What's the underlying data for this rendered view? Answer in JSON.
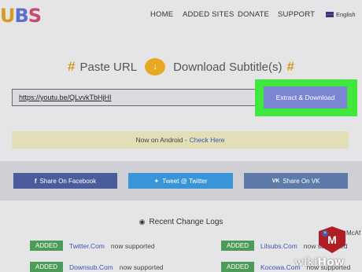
{
  "header": {
    "logo_part1": "U",
    "logo_part2": "B",
    "logo_part3": "S",
    "nav": [
      "HOME",
      "ADDED SITES",
      "DONATE",
      "SUPPORT"
    ],
    "language": "English"
  },
  "hero": {
    "hash_left": "#",
    "paste_label": "Paste URL",
    "download_label": "Download Subtitle(s)",
    "hash_right": "#"
  },
  "form": {
    "url_value": "https://youtu.be/QLvvkTbHjHI",
    "extract_button": "Extract & Download"
  },
  "banner": {
    "text": "Now on Android -",
    "link": "Check Here"
  },
  "share": {
    "facebook": "Share On Facebook",
    "twitter": "Tweet @ Twitter",
    "vk": "Share On VK"
  },
  "change_logs": {
    "title": "Recent Change Logs",
    "left": [
      {
        "badge": "ADDED",
        "site": "Twitter.Com",
        "text": "now supported"
      },
      {
        "badge": "ADDED",
        "site": "Downsub.Com",
        "text": "now supported"
      }
    ],
    "right": [
      {
        "badge": "ADDED",
        "site": "Lilsubs.Com",
        "text": "now supported"
      },
      {
        "badge": "ADDED",
        "site": "Kocowa.Com",
        "text": "now supported"
      }
    ]
  },
  "overlay": {
    "mcafee_label": "McAf",
    "watermark_1": "wiki",
    "watermark_2": "How"
  },
  "colors": {
    "accent_orange": "#d89a1e",
    "button_purple": "#7b85d4",
    "highlight_green": "#3fe83a",
    "badge_green": "#4c9b56"
  }
}
